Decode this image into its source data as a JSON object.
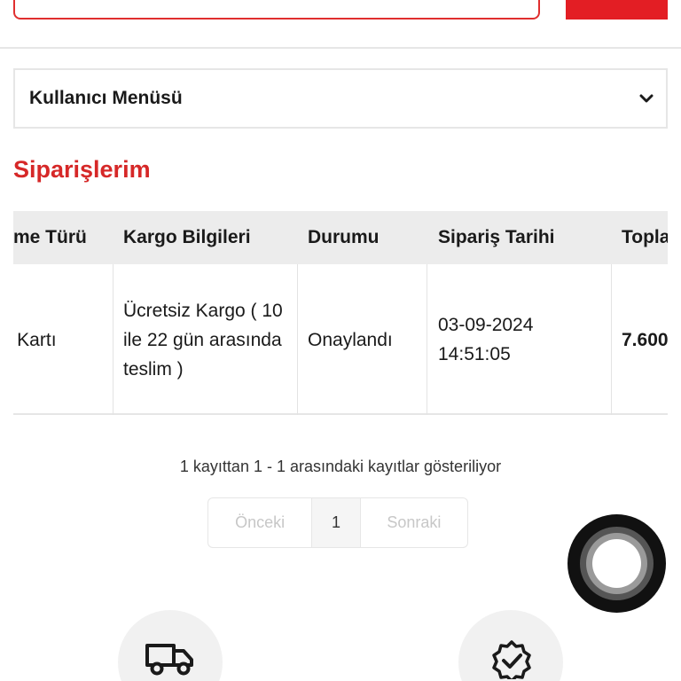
{
  "header": {
    "search_icon": "search-icon"
  },
  "user_menu": {
    "label": "Kullanıcı Menüsü",
    "icon": "chevron-down-icon"
  },
  "page": {
    "title": "Siparişlerim"
  },
  "orders_table": {
    "columns": [
      "me Türü",
      "Kargo Bilgileri",
      "Durumu",
      "Sipariş Tarihi",
      "Topla"
    ],
    "rows": [
      {
        "payment": "di Kartı",
        "shipping": "Ücretsiz Kargo ( 10 ile 22 gün arasında teslim )",
        "status": "Onaylandı",
        "date": "03-09-2024 14:51:05",
        "total": "7.600"
      }
    ]
  },
  "records_info": "1 kayıttan 1 - 1 arasındaki kayıtlar gösteriliyor",
  "pagination": {
    "prev": "Önceki",
    "current": "1",
    "next": "Sonraki"
  },
  "features": {
    "left_icon": "truck-icon",
    "right_icon": "verified-badge-icon"
  },
  "colors": {
    "accent": "#e31e24",
    "title": "#d62828",
    "header_bg": "#ececec"
  }
}
